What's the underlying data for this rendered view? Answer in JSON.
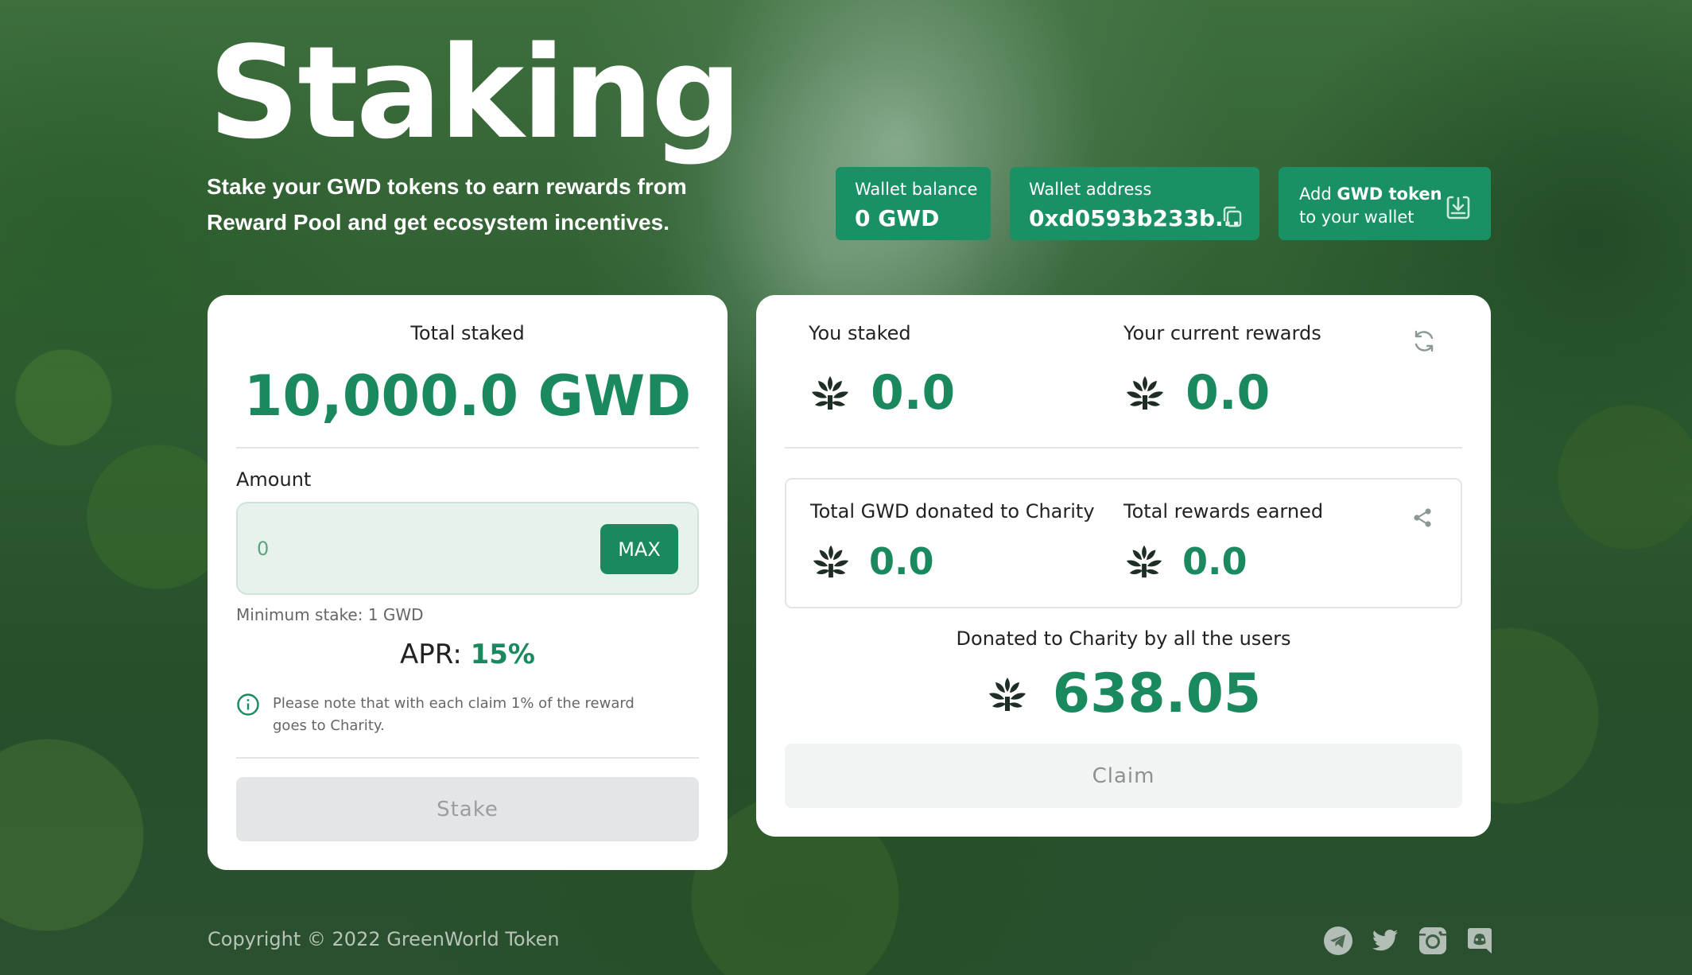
{
  "header": {
    "title": "Staking",
    "subtitle": "Stake your GWD tokens to earn rewards from Reward Pool and get ecosystem incentives."
  },
  "wallet": {
    "balance_label": "Wallet balance",
    "balance_value": "0 GWD",
    "address_label": "Wallet address",
    "address_value": "0xd0593b233b...",
    "add_token_prefix": "Add ",
    "add_token_bold": "GWD token",
    "add_token_line2": "to your wallet"
  },
  "stake_panel": {
    "total_staked_label": "Total staked",
    "total_staked_value": "10,000.0 GWD",
    "amount_label": "Amount",
    "amount_placeholder": "0",
    "max_label": "MAX",
    "min_stake": "Minimum stake: 1 GWD",
    "apr_label": "APR: ",
    "apr_value": "15%",
    "note": "Please note that with each claim 1% of the reward goes to Charity.",
    "stake_button": "Stake"
  },
  "rewards_panel": {
    "you_staked_label": "You staked",
    "you_staked_value": "0.0",
    "current_rewards_label": "Your current rewards",
    "current_rewards_value": "0.0",
    "donated_label": "Total GWD donated to Charity",
    "donated_value": "0.0",
    "rewards_earned_label": "Total rewards earned",
    "rewards_earned_value": "0.0",
    "all_users_label": "Donated to Charity by all the users",
    "all_users_value": "638.05",
    "claim_button": "Claim"
  },
  "footer": {
    "copyright": "Copyright © 2022 GreenWorld Token",
    "social_icons": [
      "telegram-icon",
      "twitter-icon",
      "instagram-icon",
      "discord-icon"
    ]
  },
  "colors": {
    "accent": "#1a8a5e",
    "chip": "#1a9165",
    "disabled_button": "#e4e5e6"
  }
}
